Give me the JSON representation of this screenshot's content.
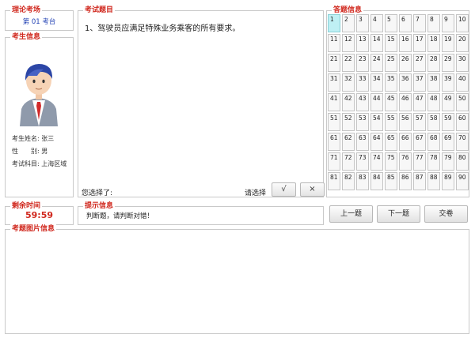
{
  "site": {
    "title": "理论考场",
    "seat": "第 01 考台"
  },
  "candidate": {
    "title": "考生信息",
    "name": "考生姓名: 张三",
    "gender": "性　　别: 男",
    "subject": "考试科目: 上海区域"
  },
  "question": {
    "title": "考试题目",
    "text": "1、驾驶员应满足特殊业务乘客的所有要求。",
    "choose_label": "您选择了:",
    "select_label": "请选择",
    "true_label": "√",
    "false_label": "×"
  },
  "answer_grid": {
    "title": "答题信息",
    "current": 1,
    "cells": [
      "1",
      "2",
      "3",
      "4",
      "5",
      "6",
      "7",
      "8",
      "9",
      "10",
      "11",
      "12",
      "13",
      "14",
      "15",
      "16",
      "17",
      "18",
      "19",
      "20",
      "21",
      "22",
      "23",
      "24",
      "25",
      "26",
      "27",
      "28",
      "29",
      "30",
      "31",
      "32",
      "33",
      "34",
      "35",
      "36",
      "37",
      "38",
      "39",
      "40",
      "41",
      "42",
      "43",
      "44",
      "45",
      "46",
      "47",
      "48",
      "49",
      "50",
      "51",
      "52",
      "53",
      "54",
      "55",
      "56",
      "57",
      "58",
      "59",
      "60",
      "61",
      "62",
      "63",
      "64",
      "65",
      "66",
      "67",
      "68",
      "69",
      "70",
      "71",
      "72",
      "73",
      "74",
      "75",
      "76",
      "77",
      "78",
      "79",
      "80",
      "81",
      "82",
      "83",
      "84",
      "85",
      "86",
      "87",
      "88",
      "89",
      "90"
    ]
  },
  "timer": {
    "title": "剩余时间",
    "value": "59:59"
  },
  "hint": {
    "title": "提示信息",
    "text": "判断题，请判断对错！"
  },
  "nav": {
    "prev": "上一题",
    "next": "下一题",
    "submit": "交卷"
  },
  "image_area": {
    "title": "考题图片信息"
  },
  "colors": {
    "accent": "#d0281e",
    "link_blue": "#1f3fb3",
    "active_cell": "#bff0f4"
  }
}
